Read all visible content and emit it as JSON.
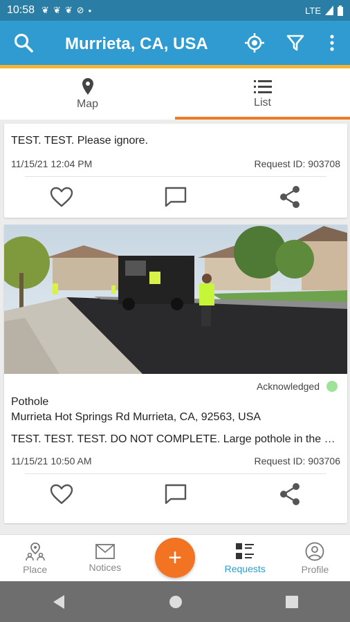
{
  "status_bar": {
    "time": "10:58",
    "network": "LTE",
    "notification_icons": [
      "bird-icon",
      "bird-icon",
      "bird-icon",
      "no-disturb-icon",
      "dot-icon"
    ]
  },
  "app_bar": {
    "title": "Murrieta, CA, USA",
    "icons": [
      "search-icon",
      "location-target-icon",
      "filter-icon",
      "more-vert-icon"
    ],
    "background_color": "#2f9bd0",
    "accent_color": "#f7b532"
  },
  "tabs": [
    {
      "label": "Map",
      "icon": "map-pin-icon",
      "active": false
    },
    {
      "label": "List",
      "icon": "list-icon",
      "active": true
    }
  ],
  "requests": [
    {
      "description": "TEST. TEST.  Please ignore.",
      "timestamp": "11/15/21 12:04 PM",
      "request_id": "Request ID: 903708"
    },
    {
      "status": "Acknowledged",
      "status_color": "#9ee39a",
      "category": "Pothole",
      "address": "Murrieta Hot Springs Rd Murrieta, CA, 92563, USA",
      "description": "TEST. TEST. TEST. DO NOT COMPLETE. Large pothole in the …",
      "timestamp": "11/15/21 10:50 AM",
      "request_id": "Request ID: 903706"
    }
  ],
  "bottom_nav": [
    {
      "label": "Place",
      "icon": "place-people-icon",
      "active": false
    },
    {
      "label": "Notices",
      "icon": "envelope-icon",
      "active": false
    },
    {
      "label": "Requests",
      "icon": "requests-list-icon",
      "active": true
    },
    {
      "label": "Profile",
      "icon": "profile-icon",
      "active": false
    }
  ],
  "fab": {
    "label": "+",
    "color": "#f27321"
  }
}
